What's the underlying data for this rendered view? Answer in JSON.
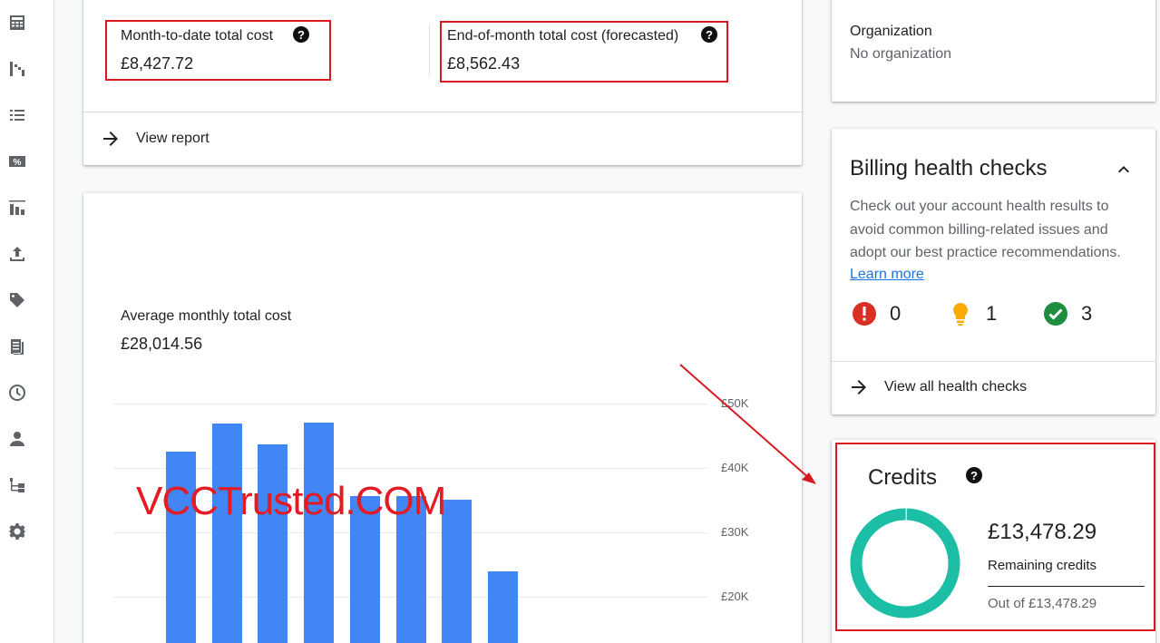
{
  "sidebar": {
    "icons": [
      "calculator-icon",
      "chart-icon",
      "list-icon",
      "discount-icon",
      "bar-chart-icon",
      "upload-icon",
      "tag-icon",
      "document-icon",
      "clock-icon",
      "person-icon",
      "hierarchy-icon",
      "gear-icon"
    ]
  },
  "cost_summary": {
    "mtd_label": "Month-to-date total cost",
    "mtd_value": "£8,427.72",
    "eom_label": "End-of-month total cost (forecasted)",
    "eom_value": "£8,562.43",
    "view_report": "View report",
    "help_glyph": "?"
  },
  "avg_cost": {
    "label": "Average monthly total cost",
    "value": "£28,014.56"
  },
  "chart_data": {
    "type": "bar",
    "ylim": [
      15000,
      50000
    ],
    "yticks": [
      "£50K",
      "£40K",
      "£30K",
      "£20K"
    ],
    "ytick_values": [
      50000,
      40000,
      30000,
      20000
    ],
    "values": [
      42500,
      46900,
      43600,
      47000,
      35600,
      35600,
      35100,
      24000
    ],
    "bar_color": "#4285f4"
  },
  "organization": {
    "label": "Organization",
    "value": "No organization"
  },
  "billing_health": {
    "title": "Billing health checks",
    "description": "Check out your account health results to avoid common billing-related issues and adopt our best practice recommendations.",
    "learn_more": "Learn more",
    "errors": "0",
    "warnings": "1",
    "passed": "3",
    "view_all": "View all health checks"
  },
  "credits": {
    "title": "Credits",
    "remaining_amount": "£13,478.29",
    "remaining_label": "Remaining credits",
    "out_of": "Out of £13,478.29",
    "remaining_fraction": 0.995,
    "ring_color": "#1cbfa6",
    "help_glyph": "?"
  },
  "watermark": "VCCTrusted.COM",
  "colors": {
    "annotation_red": "#d81920",
    "error": "#d93025",
    "warning": "#f9ab00",
    "success": "#1e8e3e"
  }
}
